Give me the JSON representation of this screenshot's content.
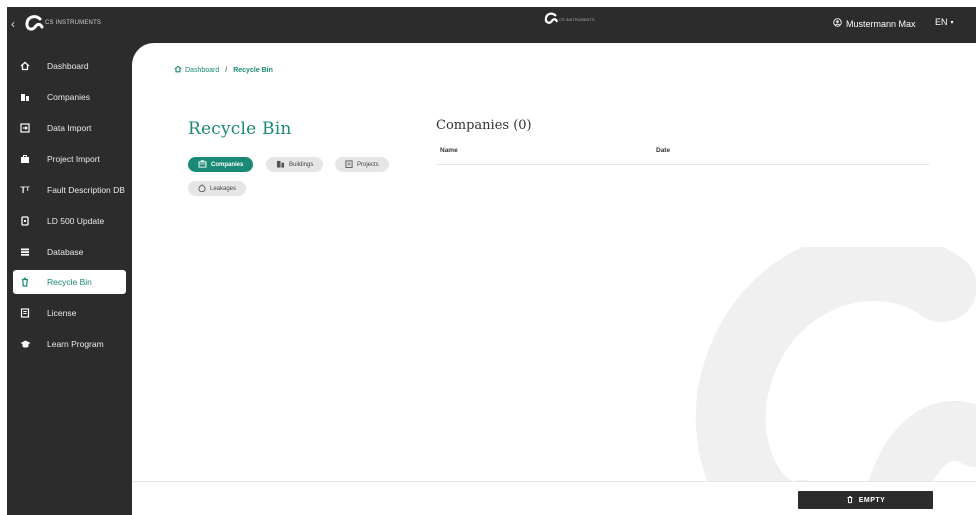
{
  "topbar": {
    "back_icon": "chevron-left-icon",
    "brand_text": "CS INSTRUMENTS",
    "center_brand_text": "CS INSTRUMENTS",
    "user_name": "Mustermann Max",
    "user_icon": "user-circle-icon",
    "language": "EN",
    "language_icon": "caret-down-icon"
  },
  "sidebar": {
    "items": [
      {
        "label": "Dashboard",
        "icon": "home-icon"
      },
      {
        "label": "Companies",
        "icon": "building-icon"
      },
      {
        "label": "Data Import",
        "icon": "import-icon"
      },
      {
        "label": "Project Import",
        "icon": "briefcase-icon"
      },
      {
        "label": "Fault Description DB",
        "icon": "text-size-icon"
      },
      {
        "label": "LD 500 Update",
        "icon": "device-icon"
      },
      {
        "label": "Database",
        "icon": "database-icon"
      },
      {
        "label": "Recycle Bin",
        "icon": "trash-icon"
      },
      {
        "label": "License",
        "icon": "license-icon"
      },
      {
        "label": "Learn Program",
        "icon": "graduation-cap-icon"
      }
    ],
    "active": "Recycle Bin"
  },
  "breadcrumb": {
    "home": "Dashboard",
    "separator": "/",
    "current": "Recycle Bin"
  },
  "page": {
    "title": "Recycle Bin",
    "filters": [
      {
        "label": "Companies",
        "icon": "building-icon",
        "active": true
      },
      {
        "label": "Buildings",
        "icon": "buildings-icon",
        "active": false
      },
      {
        "label": "Projects",
        "icon": "clipboard-icon",
        "active": false
      },
      {
        "label": "Leakages",
        "icon": "drop-icon",
        "active": false
      }
    ],
    "section_title": "Companies (0)",
    "columns": [
      "Name",
      "Date"
    ],
    "rows": []
  },
  "footer": {
    "empty_label": "EMPTY",
    "empty_icon": "trash-icon"
  },
  "colors": {
    "accent": "#1a8a76",
    "dark": "#2c2c2c",
    "chip": "#e6e6e6"
  }
}
